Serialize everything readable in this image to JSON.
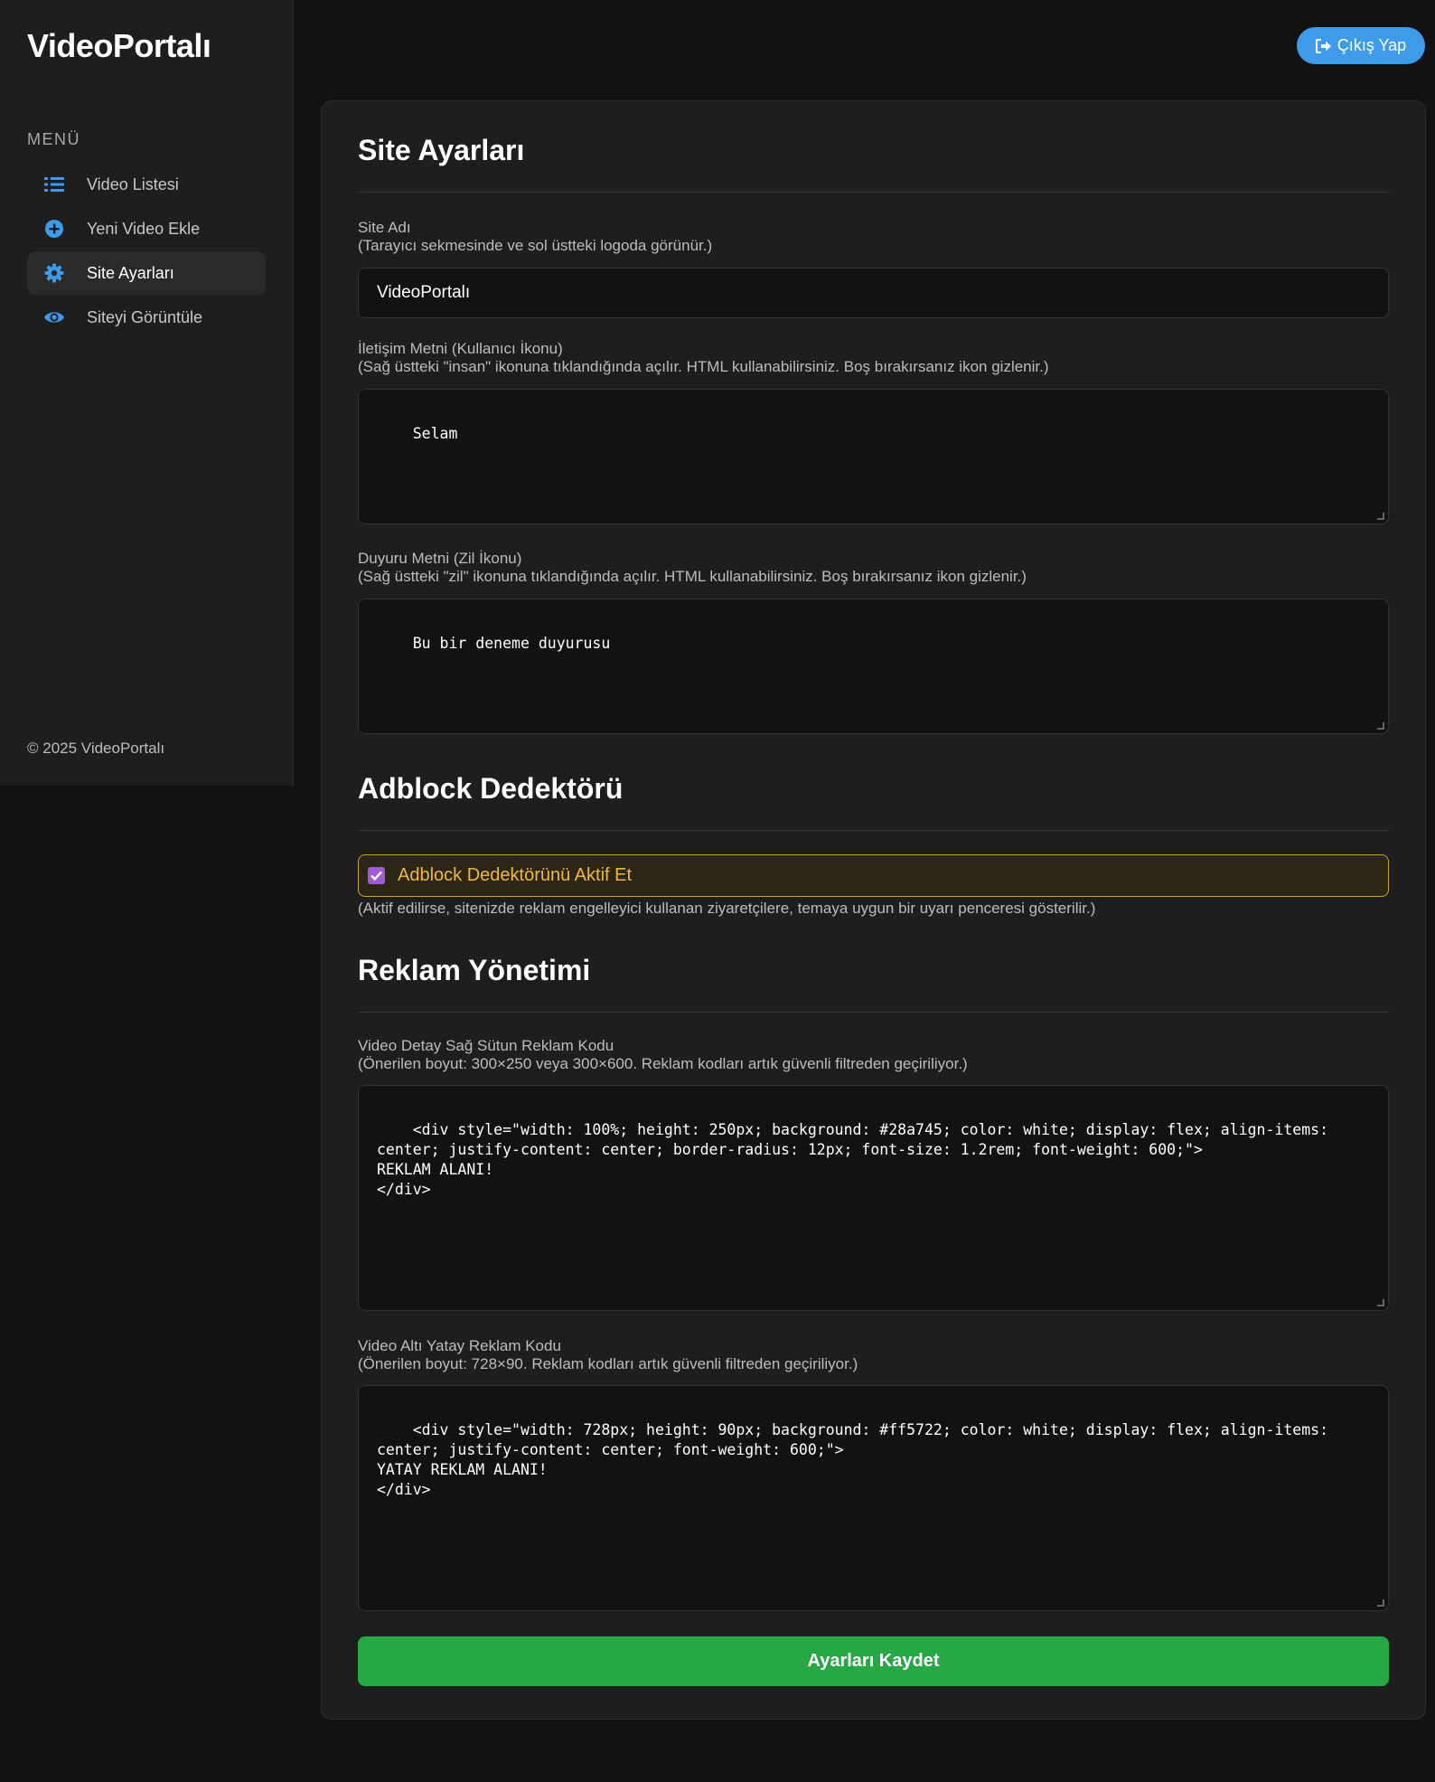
{
  "app": {
    "logo": "VideoPortalı",
    "copyright": "© 2025 VideoPortalı"
  },
  "colors": {
    "accent": "#3d9be9",
    "save": "#28a745",
    "warning": "#f4b63b",
    "checkbox": "#a25bd8"
  },
  "sidebar": {
    "heading": "MENÜ",
    "items": [
      {
        "label": "Video Listesi",
        "icon": "list-icon",
        "active": false
      },
      {
        "label": "Yeni Video Ekle",
        "icon": "plus-circle-icon",
        "active": false
      },
      {
        "label": "Site Ayarları",
        "icon": "gear-icon",
        "active": true
      },
      {
        "label": "Siteyi Görüntüle",
        "icon": "eye-icon",
        "active": false
      }
    ]
  },
  "header": {
    "logout_label": "Çıkış Yap"
  },
  "settings": {
    "title": "Site Ayarları",
    "site_name": {
      "label": "Site Adı",
      "hint": "(Tarayıcı sekmesinde ve sol üstteki logoda görünür.)",
      "value": "VideoPortalı"
    },
    "contact": {
      "label": "İletişim Metni (Kullanıcı İkonu)",
      "hint": "(Sağ üstteki \"insan\" ikonuna tıklandığında açılır. HTML kullanabilirsiniz. Boş bırakırsanız ikon gizlenir.)",
      "value": "Selam"
    },
    "announcement": {
      "label": "Duyuru Metni (Zil İkonu)",
      "hint": "(Sağ üstteki \"zil\" ikonuna tıklandığında açılır. HTML kullanabilirsiniz. Boş bırakırsanız ikon gizlenir.)",
      "value": "Bu bir deneme duyurusu"
    }
  },
  "adblock": {
    "title": "Adblock Dedektörü",
    "checkbox_label": "Adblock Dedektörünü Aktif Et",
    "checked": true,
    "hint": "(Aktif edilirse, sitenizde reklam engelleyici kullanan ziyaretçilere, temaya uygun bir uyarı penceresi gösterilir.)"
  },
  "ads": {
    "title": "Reklam Yönetimi",
    "sidebar_ad": {
      "label": "Video Detay Sağ Sütun Reklam Kodu",
      "hint": "(Önerilen boyut: 300×250 veya 300×600. Reklam kodları artık güvenli filtreden geçiriliyor.)",
      "value": "<div style=\"width: 100%; height: 250px; background: #28a745; color: white; display: flex; align-items: center; justify-content: center; border-radius: 12px; font-size: 1.2rem; font-weight: 600;\">\nREKLAM ALANI!\n</div>"
    },
    "horizontal_ad": {
      "label": "Video Altı Yatay Reklam Kodu",
      "hint": "(Önerilen boyut: 728×90. Reklam kodları artık güvenli filtreden geçiriliyor.)",
      "value": "<div style=\"width: 728px; height: 90px; background: #ff5722; color: white; display: flex; align-items: center; justify-content: center; font-weight: 600;\">\nYATAY REKLAM ALANI!\n</div>"
    }
  },
  "save_label": "Ayarları Kaydet"
}
